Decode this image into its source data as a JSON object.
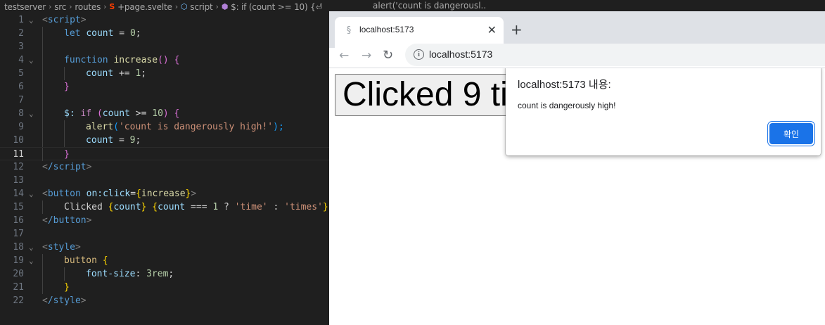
{
  "editor": {
    "breadcrumb": [
      "testserver",
      "src",
      "routes",
      "+page.svelte",
      "script",
      "$: if (count >= 10) {⏎"
    ],
    "lines": [
      "1",
      "2",
      "3",
      "4",
      "5",
      "6",
      "7",
      "8",
      "9",
      "10",
      "11",
      "12",
      "13",
      "14",
      "15",
      "16",
      "17",
      "18",
      "19",
      "20",
      "21",
      "22"
    ],
    "active_line": "11",
    "code": {
      "l1_tag": "script",
      "l2_kw": "let",
      "l2_var": "count",
      "l2_op": " = ",
      "l2_num": "0",
      "l2_end": ";",
      "l4_kw": "function",
      "l4_fn": "increase",
      "l4_rest": "() {",
      "l5_var": "count",
      "l5_op": " += ",
      "l5_num": "1",
      "l5_end": ";",
      "l6": "}",
      "l8_label": "$:",
      "l8_ctrl": "if",
      "l8_open": " (",
      "l8_var": "count",
      "l8_op": " >= ",
      "l8_num": "10",
      "l8_close": ") {",
      "l9_fn": "alert",
      "l9_open": "(",
      "l9_str": "'count is dangerously high!'",
      "l9_close": ");",
      "l10_var": "count",
      "l10_op": " = ",
      "l10_num": "9",
      "l10_end": ";",
      "l11": "}",
      "l12_tag": "/script",
      "l14_tag": "button",
      "l14_attr": "on:click",
      "l14_eq": "=",
      "l14_open": "{",
      "l14_fn": "increase",
      "l14_close": "}",
      "l15_text": "Clicked ",
      "l15_o1": "{",
      "l15_v1": "count",
      "l15_c1": "}",
      "l15_sp": " ",
      "l15_o2": "{",
      "l15_v2": "count",
      "l15_op": " === ",
      "l15_num": "1",
      "l15_q": " ? ",
      "l15_s1": "'time'",
      "l15_colon": " : ",
      "l15_s2": "'times'",
      "l15_c2": "}",
      "l16_tag": "/button",
      "l18_tag": "style",
      "l19_sel": "button",
      "l19_open": " {",
      "l20_prop": "font-size",
      "l20_colon": ": ",
      "l20_val": "3rem",
      "l20_end": ";",
      "l21": "}",
      "l22_tag": "/style"
    },
    "top_tab_fragment": "alert('count is dangerousl..."
  },
  "browser": {
    "tab_title": "localhost:5173",
    "url": "localhost:5173",
    "page_button_text": "Clicked 9 times",
    "dialog": {
      "title": "localhost:5173 내용:",
      "message": "count is dangerously high!",
      "ok_label": "확인"
    },
    "accent_color": "#1a73e8"
  }
}
